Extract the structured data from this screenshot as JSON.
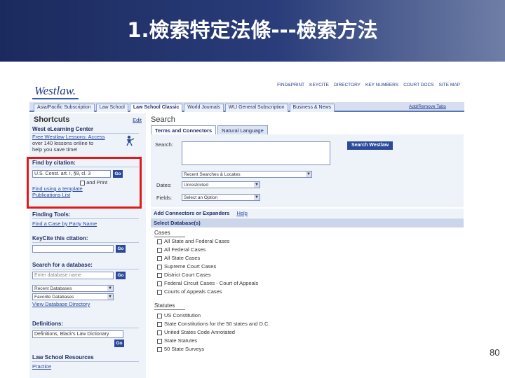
{
  "slide": {
    "title": "1.檢索特定法條---檢索方法",
    "page_number": "80"
  },
  "westlaw": {
    "logo": "Westlaw.",
    "util_links": [
      "FIND&PRINT",
      "KEYCITE",
      "DIRECTORY",
      "KEY NUMBERS",
      "COURT DOCS",
      "SITE MAP"
    ],
    "tabs": [
      "Asia/Pacific Subscription",
      "Law School",
      "Law School Classic",
      "World Journals",
      "WLI General Subscription",
      "Business & News"
    ],
    "active_tab": "Law School Classic",
    "add_remove_tabs": "Add/Remove Tabs"
  },
  "shortcuts": {
    "title": "Shortcuts",
    "edit": "Edit",
    "elearning": {
      "heading": "West eLearning Center",
      "text_1": "Free Westlaw Lessons: Access",
      "text_2": "over 140 lessons online to",
      "text_3": "help you save time!"
    },
    "find_by_citation": {
      "heading": "Find by citation:",
      "value": "U.S. Const. art. I, §9, cl. 3",
      "go": "Go",
      "and_print": "and Print",
      "link_template": "Find using a template",
      "link_publist": "Publications List"
    },
    "finding_tools": {
      "heading": "Finding Tools:",
      "link": "Find a Case by Party Name"
    },
    "keycite": {
      "heading": "KeyCite this citation:",
      "go": "Go"
    },
    "search_db": {
      "heading": "Search for a database:",
      "placeholder": "Enter database name",
      "go": "Go",
      "select_1": "Recent Databases",
      "select_2": "Favorite Databases",
      "link": "View Database Directory"
    },
    "definitions": {
      "heading": "Definitions:",
      "value": "Definitions, Black's Law Dictionary",
      "go": "Go"
    },
    "law_school_resources": {
      "heading": "Law School Resources",
      "link_1": "Practice"
    }
  },
  "search": {
    "title": "Search",
    "subtab_terms": "Terms and Connectors",
    "subtab_natural": "Natural Language",
    "search_label": "Search:",
    "button": "Search Westlaw",
    "recent": "Recent Searches & Locates",
    "dates_label": "Dates:",
    "dates_value": "Unrestricted",
    "fields_label": "Fields:",
    "fields_value": "Select an Option",
    "add_connectors": "Add Connectors or Expanders",
    "help": "Help",
    "select_databases": "Select Database(s)"
  },
  "databases": {
    "cases_heading": "Cases",
    "cases": [
      "All State and Federal Cases",
      "All Federal Cases",
      "All State Cases",
      "Supreme Court Cases",
      "District Court Cases",
      "Federal Circuit Cases - Court of Appeals",
      "Courts of Appeals Cases"
    ],
    "statutes_heading": "Statutes",
    "statutes": [
      "US Constitution",
      "State Constitutions for the 50 states and D.C.",
      "United States Code Annotated",
      "State Statutes",
      "50 State Surveys"
    ]
  }
}
